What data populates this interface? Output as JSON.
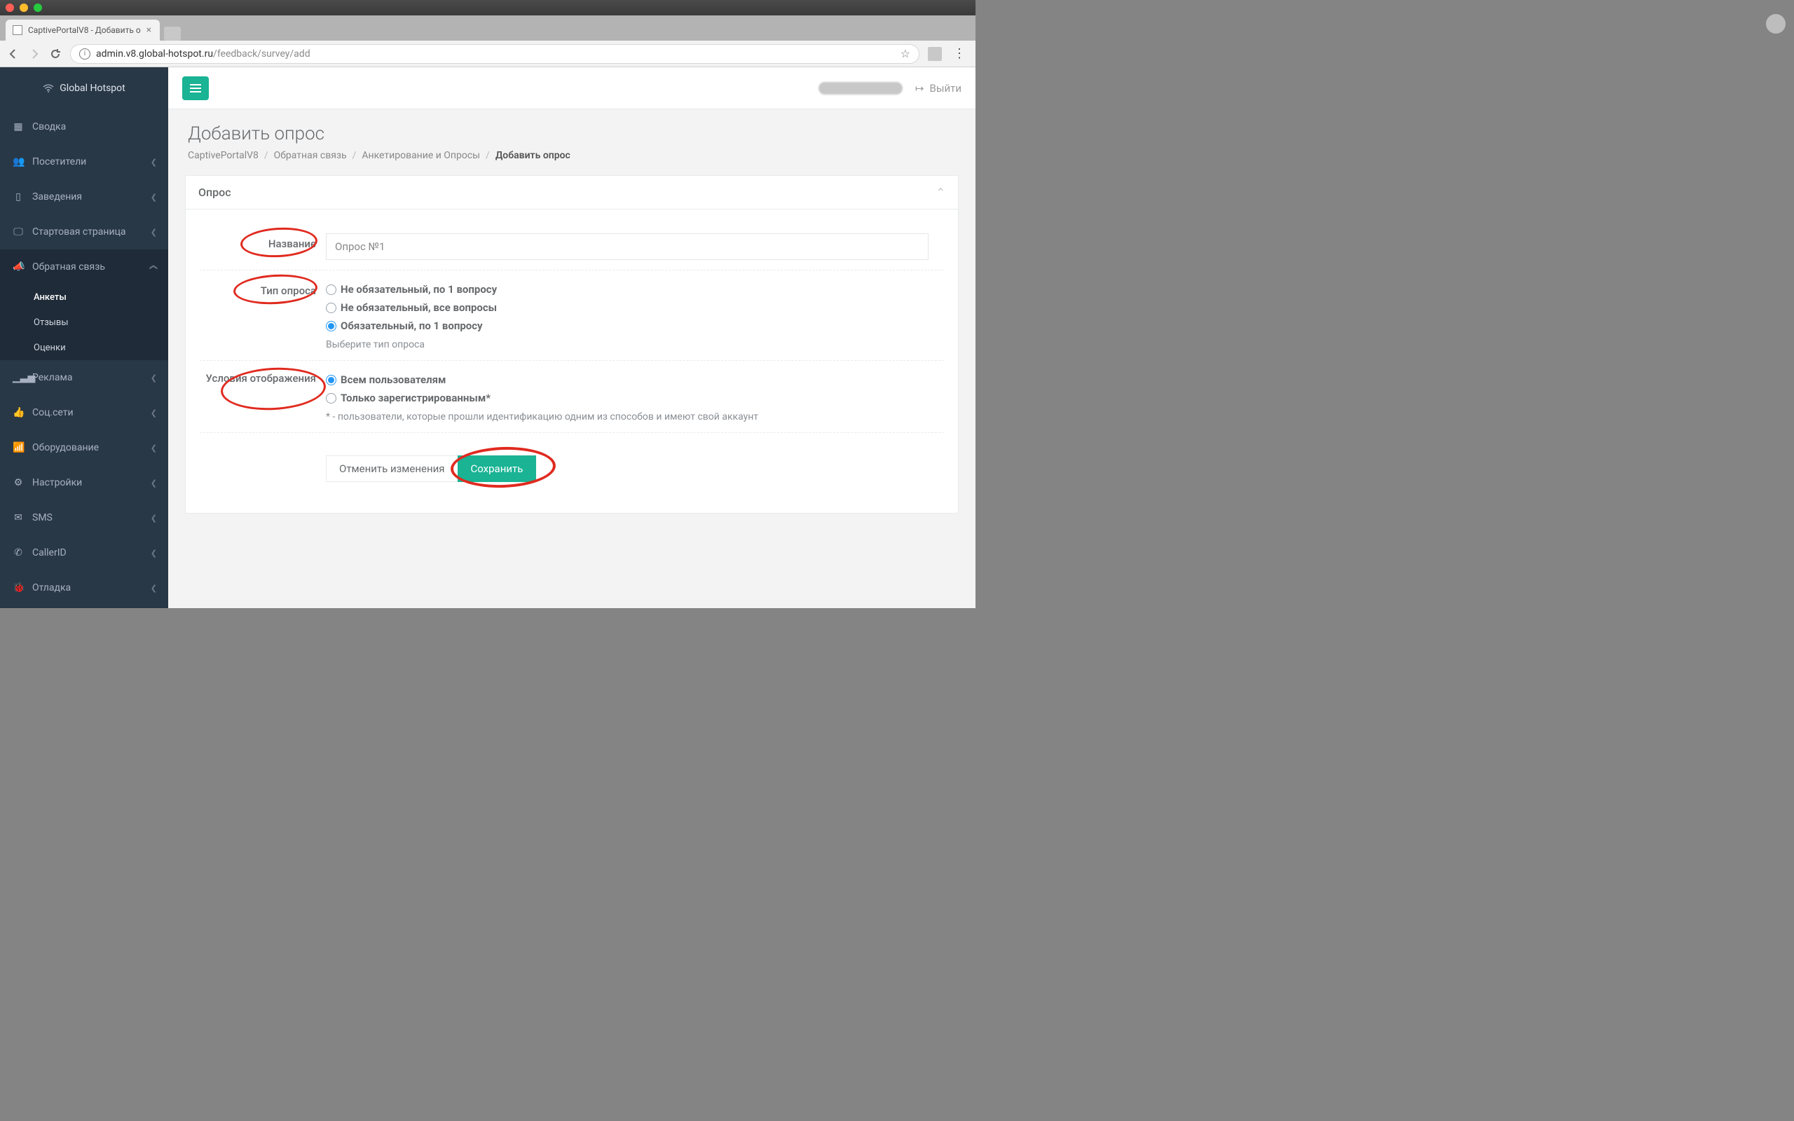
{
  "browser": {
    "tab_title": "CaptivePortalV8 - Добавить о",
    "url_domain": "admin.v8.global-hotspot.ru",
    "url_path": "/feedback/survey/add"
  },
  "logo": "Global Hotspot",
  "sidebar": [
    {
      "icon": "grid",
      "label": "Сводка",
      "expandable": false
    },
    {
      "icon": "users",
      "label": "Посетители",
      "expandable": true
    },
    {
      "icon": "tablet",
      "label": "Заведения",
      "expandable": true
    },
    {
      "icon": "monitor",
      "label": "Стартовая страница",
      "expandable": true
    },
    {
      "icon": "megaphone",
      "label": "Обратная связь",
      "expandable": true,
      "open": true,
      "children": [
        {
          "label": "Анкеты",
          "active": true
        },
        {
          "label": "Отзывы"
        },
        {
          "label": "Оценки"
        }
      ]
    },
    {
      "icon": "chart",
      "label": "Реклама",
      "expandable": true
    },
    {
      "icon": "thumb",
      "label": "Соц.сети",
      "expandable": true
    },
    {
      "icon": "wifi",
      "label": "Оборудование",
      "expandable": true
    },
    {
      "icon": "gears",
      "label": "Настройки",
      "expandable": true
    },
    {
      "icon": "mail",
      "label": "SMS",
      "expandable": true
    },
    {
      "icon": "phone",
      "label": "CallerID",
      "expandable": true
    },
    {
      "icon": "bug",
      "label": "Отладка",
      "expandable": true
    }
  ],
  "topbar": {
    "logout": "Выйти"
  },
  "page": {
    "title": "Добавить опрос",
    "crumbs": [
      "CaptivePortalV8",
      "Обратная связь",
      "Анкетирование и Опросы",
      "Добавить опрос"
    ]
  },
  "panel": {
    "title": "Опрос"
  },
  "form": {
    "name_label": "Название",
    "name_value": "Опрос №1",
    "type_label": "Тип опроса",
    "type_options": [
      {
        "label": "Не обязательный, по 1 вопросу",
        "checked": false
      },
      {
        "label": "Не обязательный, все вопросы",
        "checked": false
      },
      {
        "label": "Обязательный, по 1 вопросу",
        "checked": true
      }
    ],
    "type_help": "Выберите тип опроса",
    "cond_label": "Условия отображения",
    "cond_options": [
      {
        "label": "Всем пользователям",
        "checked": true
      },
      {
        "label": "Только зарегистрированным*",
        "checked": false
      }
    ],
    "cond_help": "* - пользователи, которые прошли идентификацию одним из способов и имеют свой аккаунт",
    "cancel": "Отменить изменения",
    "save": "Сохранить"
  }
}
